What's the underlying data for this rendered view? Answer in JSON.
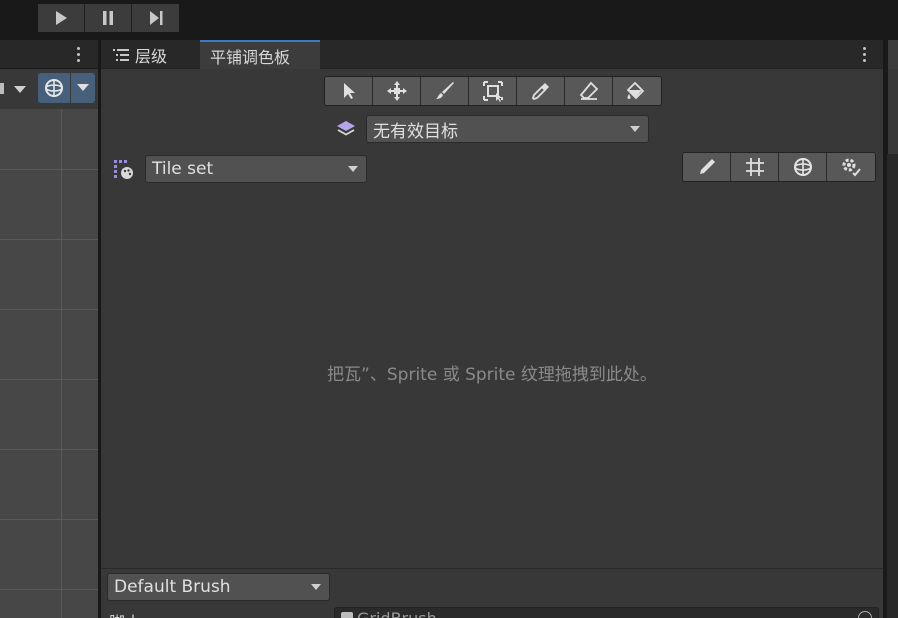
{
  "toolbar": {
    "play_icon": "play-icon",
    "pause_icon": "pause-icon",
    "step_icon": "step-icon"
  },
  "tabs": {
    "hierarchy": "层级",
    "tile_palette": "平铺调色板"
  },
  "palette": {
    "tools": [
      "select-tool-icon",
      "move-tool-icon",
      "paint-brush-icon",
      "box-fill-icon",
      "picker-icon",
      "eraser-icon",
      "fill-icon"
    ],
    "active_target": "无有效目标",
    "palette_dropdown": "Tile set",
    "edit_tools": [
      "pencil-icon",
      "grid-icon",
      "gizmo-icon",
      "settings-icon"
    ],
    "empty_message": "把瓦”、Sprite 或 Sprite 纹理拖拽到此处。",
    "brush_dropdown": "Default Brush",
    "script_label": "脚本",
    "script_value": "GridBrush"
  },
  "colors": {
    "accent": "#3a79bb",
    "panel": "#383838",
    "viewport": "#474747"
  }
}
